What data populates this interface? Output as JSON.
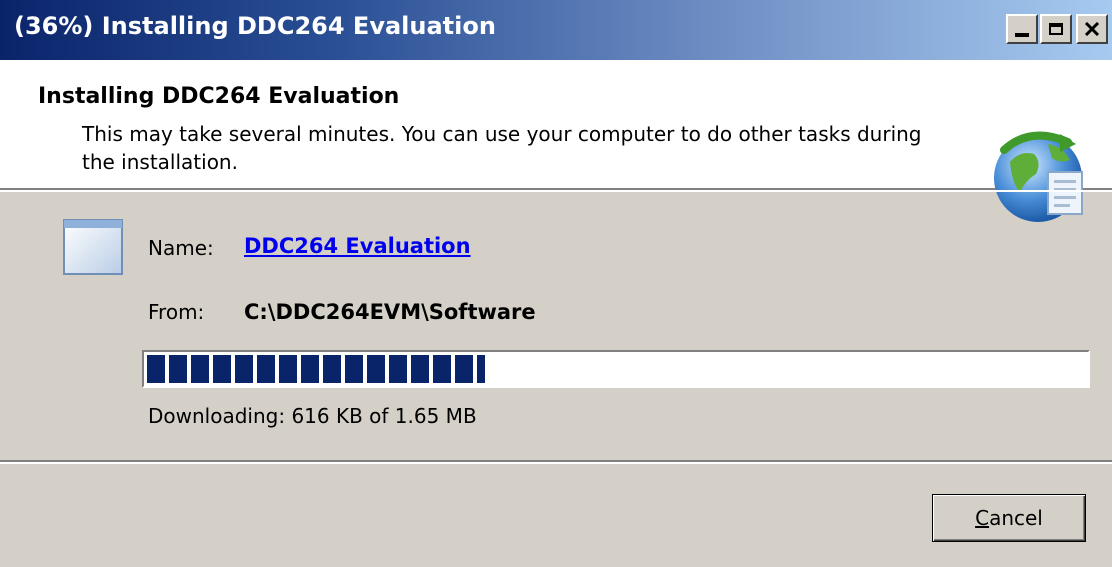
{
  "window": {
    "title": "(36%) Installing DDC264 Evaluation"
  },
  "header": {
    "title": "Installing DDC264 Evaluation",
    "description": "This may take several minutes. You can use your computer to do other tasks during the installation."
  },
  "details": {
    "name_label": "Name:",
    "name_value": "DDC264 Evaluation",
    "from_label": "From:",
    "from_value": "C:\\DDC264EVM\\Software"
  },
  "progress": {
    "percent": 36,
    "status": "Downloading: 616 KB of 1.65 MB"
  },
  "buttons": {
    "cancel_mnemonic": "C",
    "cancel_rest": "ancel"
  },
  "colors": {
    "progress_fill": "#0a246a",
    "link": "#0000ee"
  },
  "icons": {
    "header": "globe-install-icon",
    "application": "application-window-icon"
  }
}
